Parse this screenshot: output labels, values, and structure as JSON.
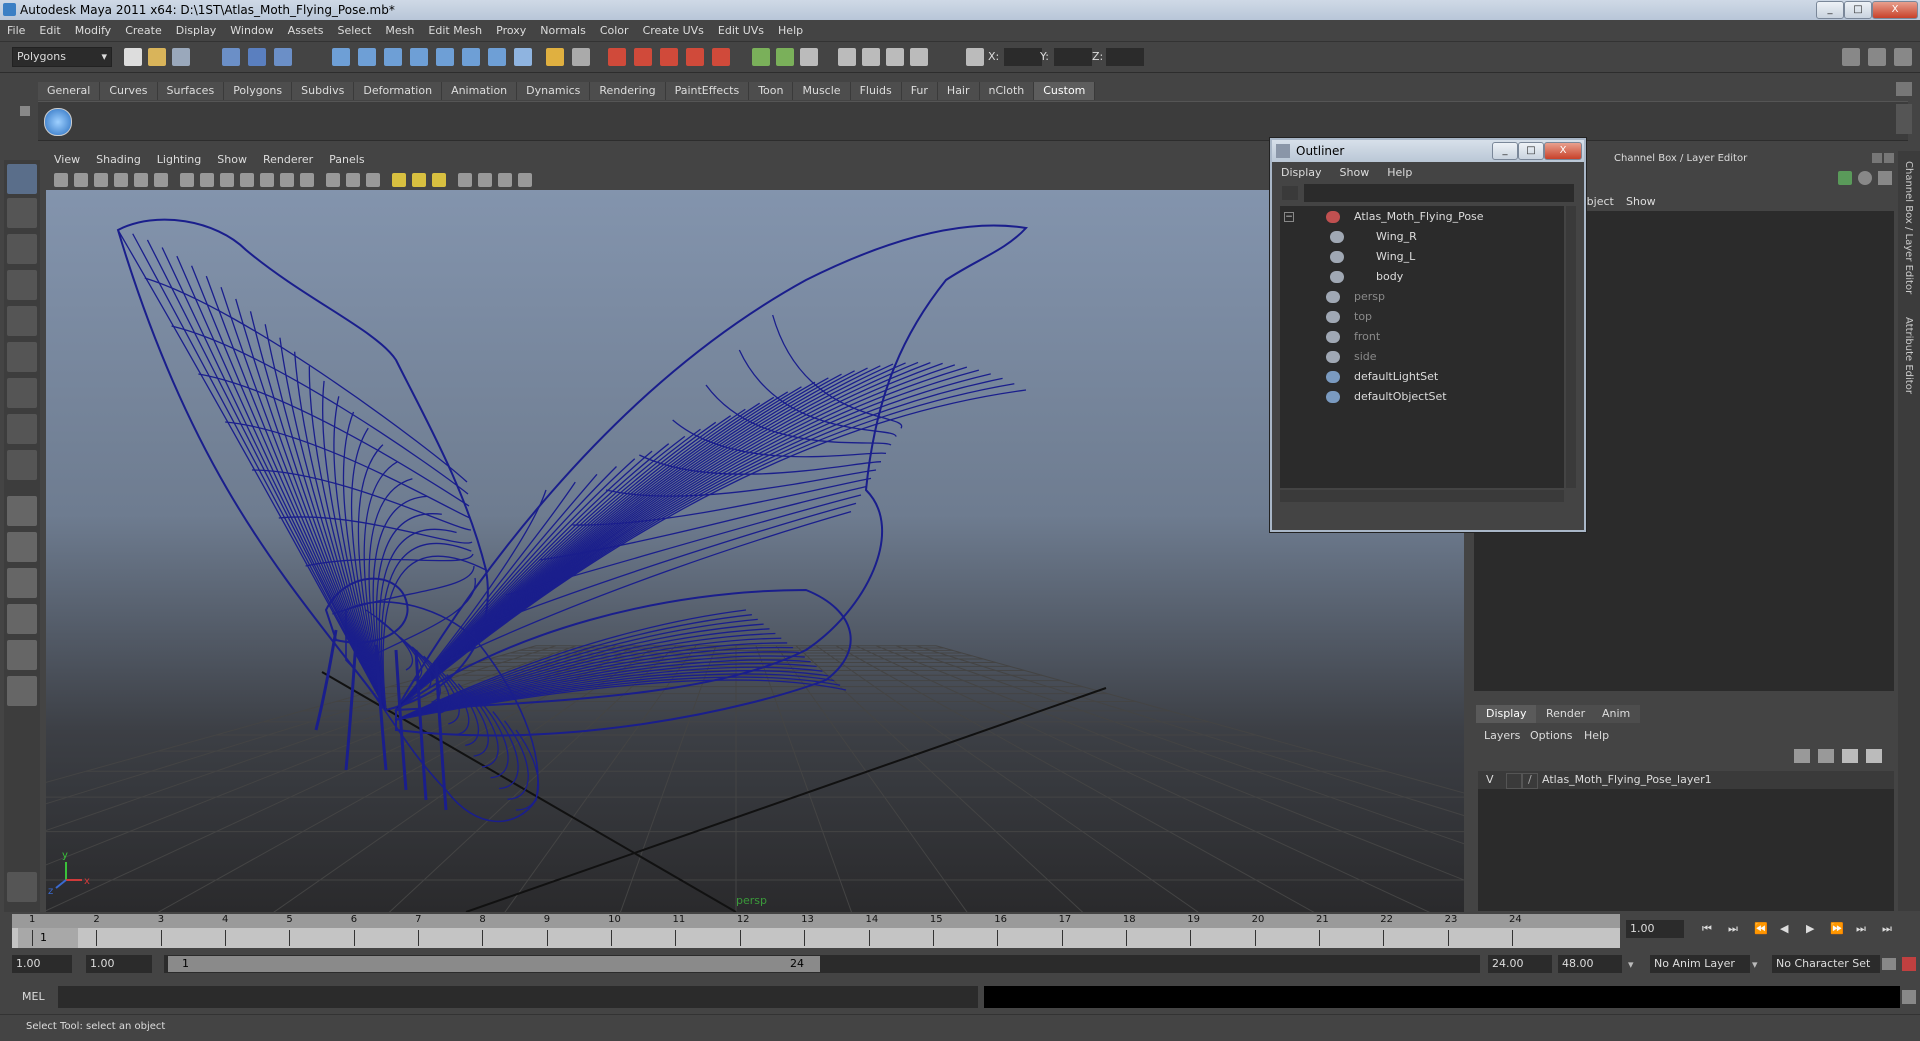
{
  "window": {
    "title": "Autodesk Maya 2011 x64: D:\\1ST\\Atlas_Moth_Flying_Pose.mb*",
    "buttons": [
      "_",
      "□",
      "X"
    ]
  },
  "menubar": [
    "File",
    "Edit",
    "Modify",
    "Create",
    "Display",
    "Window",
    "Assets",
    "Select",
    "Mesh",
    "Edit Mesh",
    "Proxy",
    "Normals",
    "Color",
    "Create UVs",
    "Edit UVs",
    "Help"
  ],
  "status": {
    "mode": "Polygons",
    "x_label": "X:",
    "y_label": "Y:",
    "z_label": "Z:"
  },
  "shelf": {
    "tabs": [
      "General",
      "Curves",
      "Surfaces",
      "Polygons",
      "Subdivs",
      "Deformation",
      "Animation",
      "Dynamics",
      "Rendering",
      "PaintEffects",
      "Toon",
      "Muscle",
      "Fluids",
      "Fur",
      "Hair",
      "nCloth",
      "Custom"
    ],
    "active": "Custom"
  },
  "viewport": {
    "menu": [
      "View",
      "Shading",
      "Lighting",
      "Show",
      "Renderer",
      "Panels"
    ],
    "camera_label": "persp",
    "axis_x": "x",
    "axis_y": "y",
    "axis_z": "z"
  },
  "outliner": {
    "title": "Outliner",
    "menu": [
      "Display",
      "Show",
      "Help"
    ],
    "items": [
      {
        "label": "Atlas_Moth_Flying_Pose",
        "dim": false,
        "indent": 0
      },
      {
        "label": "Wing_R",
        "dim": false,
        "indent": 1
      },
      {
        "label": "Wing_L",
        "dim": false,
        "indent": 1
      },
      {
        "label": "body",
        "dim": false,
        "indent": 1
      },
      {
        "label": "persp",
        "dim": true,
        "indent": 0
      },
      {
        "label": "top",
        "dim": true,
        "indent": 0
      },
      {
        "label": "front",
        "dim": true,
        "indent": 0
      },
      {
        "label": "side",
        "dim": true,
        "indent": 0
      },
      {
        "label": "defaultLightSet",
        "dim": false,
        "indent": 0
      },
      {
        "label": "defaultObjectSet",
        "dim": false,
        "indent": 0
      }
    ]
  },
  "channel_box": {
    "title": "Channel Box / Layer Editor",
    "menu_object": "Object",
    "menu_show": "Show"
  },
  "layer_editor": {
    "tabs": [
      "Display",
      "Render",
      "Anim"
    ],
    "menu": [
      "Layers",
      "Options",
      "Help"
    ],
    "layer_visibility": "V",
    "layer_name": "Atlas_Moth_Flying_Pose_layer1"
  },
  "side_tabs": [
    "Channel Box / Layer Editor",
    "Attribute Editor"
  ],
  "timeline": {
    "ticks": [
      "1",
      "2",
      "3",
      "4",
      "5",
      "6",
      "7",
      "8",
      "9",
      "10",
      "11",
      "12",
      "13",
      "14",
      "15",
      "16",
      "17",
      "18",
      "19",
      "20",
      "21",
      "22",
      "23",
      "24"
    ],
    "current_frame": "1",
    "current_time": "1.00"
  },
  "range": {
    "start_time": "1.00",
    "start_range": "1.00",
    "slider_start": "1",
    "slider_end": "24",
    "end_range": "24.00",
    "end_time": "48.00",
    "anim_layer": "No Anim Layer",
    "character_set": "No Character Set"
  },
  "mel_label": "MEL",
  "help_text": "Select Tool: select an object",
  "colors": {
    "wireframe": "#1a1e8c",
    "viewport_top": "#8394ad",
    "viewport_bottom": "#2a2a2c",
    "panel": "#444444"
  }
}
